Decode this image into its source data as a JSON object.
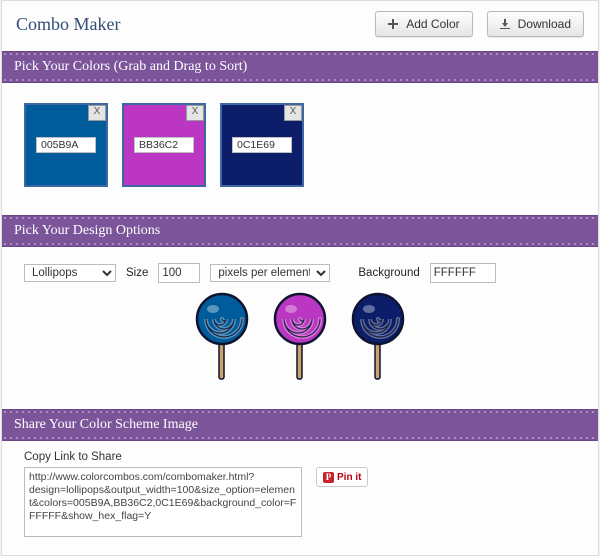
{
  "header": {
    "title": "Combo Maker",
    "add_color_label": "Add Color",
    "download_label": "Download"
  },
  "sections": {
    "colors_title": "Pick Your Colors (Grab and Drag to Sort)",
    "options_title": "Pick Your Design Options",
    "share_title": "Share Your Color Scheme Image"
  },
  "colors": [
    {
      "hex": "005B9A",
      "close_label": "X"
    },
    {
      "hex": "BB36C2",
      "close_label": "X"
    },
    {
      "hex": "0C1E69",
      "close_label": "X"
    }
  ],
  "options": {
    "design_value": "Lollipops",
    "size_label": "Size",
    "size_value": "100",
    "units_value": "pixels per element",
    "background_label": "Background",
    "background_value": "FFFFFF"
  },
  "share": {
    "copy_label": "Copy Link to Share",
    "url": "http://www.colorcombos.com/combomaker.html?design=lollipops&output_width=100&size_option=element&colors=005B9A,BB36C2,0C1E69&background_color=FFFFFF&show_hex_flag=Y",
    "pinit_label": "Pin it"
  }
}
